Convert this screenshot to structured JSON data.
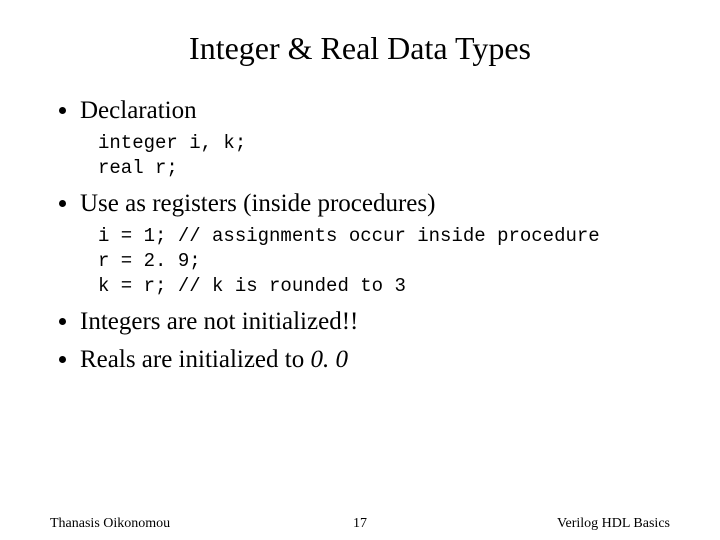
{
  "title": "Integer & Real Data Types",
  "bullets": {
    "b1": "Declaration",
    "b2": "Use as registers (inside procedures)",
    "b3_prefix": "Integers are not initialized!!",
    "b4_prefix": "Reals are initialized to ",
    "b4_ital": "0. 0"
  },
  "code1": "integer i, k;\nreal r;",
  "code2": "i = 1; // assignments occur inside procedure\nr = 2. 9;\nk = r; // k is rounded to 3",
  "footer": {
    "author": "Thanasis Oikonomou",
    "page": "17",
    "course": "Verilog HDL Basics"
  }
}
